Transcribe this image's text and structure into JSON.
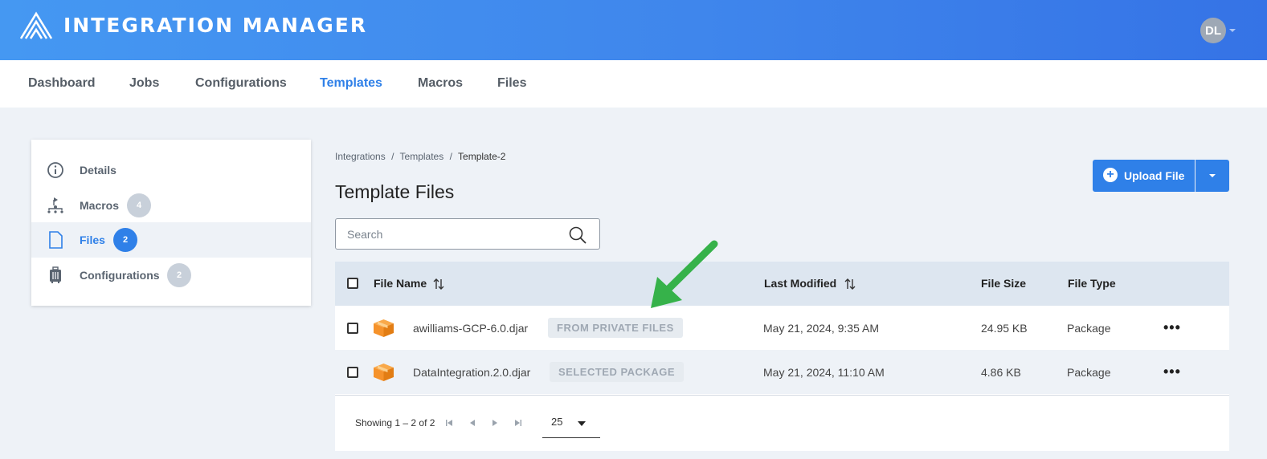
{
  "header": {
    "app_title": "INTEGRATION MANAGER",
    "avatar_initials": "DL"
  },
  "nav": {
    "items": [
      {
        "label": "Dashboard"
      },
      {
        "label": "Jobs"
      },
      {
        "label": "Configurations"
      },
      {
        "label": "Templates",
        "active": true
      },
      {
        "label": "Macros"
      },
      {
        "label": "Files"
      }
    ]
  },
  "sidebar": {
    "items": [
      {
        "label": "Details",
        "icon": "info-icon"
      },
      {
        "label": "Macros",
        "icon": "flow-icon",
        "badge": "4"
      },
      {
        "label": "Files",
        "icon": "file-icon",
        "badge": "2",
        "active": true
      },
      {
        "label": "Configurations",
        "icon": "luggage-icon",
        "badge": "2"
      }
    ]
  },
  "breadcrumb": {
    "crumb1": "Integrations",
    "crumb2": "Templates",
    "current": "Template-2",
    "sep": "/"
  },
  "page_title": "Template Files",
  "upload": {
    "label": "Upload File"
  },
  "search": {
    "placeholder": "Search"
  },
  "table": {
    "headers": {
      "file_name": "File Name",
      "last_modified": "Last Modified",
      "file_size": "File Size",
      "file_type": "File Type"
    },
    "rows": [
      {
        "name": "awilliams-GCP-6.0.djar",
        "tag": "FROM PRIVATE FILES",
        "modified": "May 21, 2024, 9:35 AM",
        "size": "24.95 KB",
        "type": "Package"
      },
      {
        "name": "DataIntegration.2.0.djar",
        "tag": "SELECTED PACKAGE",
        "modified": "May 21, 2024, 11:10 AM",
        "size": "4.86 KB",
        "type": "Package"
      }
    ],
    "more_glyph": "•••"
  },
  "pagination": {
    "showing": "Showing 1 – 2 of 2",
    "page_size": "25"
  },
  "colors": {
    "accent": "#2f80e8",
    "header_start": "#4598f2",
    "header_end": "#3573e6",
    "package_orange": "#f5922b",
    "arrow_green": "#36b24a"
  }
}
